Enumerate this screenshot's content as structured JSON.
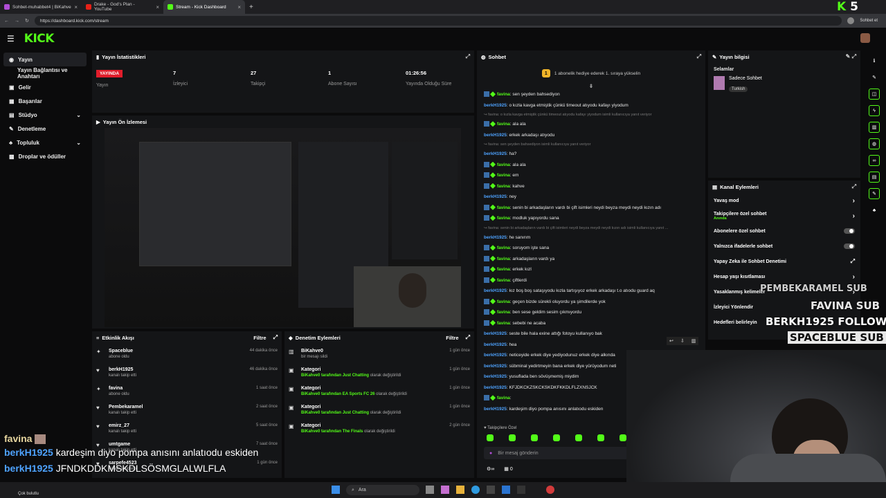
{
  "browser": {
    "tabs": [
      {
        "title": "Sohbet-muhabbet4 | BiKahve"
      },
      {
        "title": "Drake - God's Plan - YouTube"
      },
      {
        "title": "Stream - Kick Dashboard"
      }
    ],
    "url": "https://dashboard.kick.com/stream",
    "profile_label": "Sohbet et"
  },
  "brand": {
    "logo": "KICK",
    "corner_badge": "5"
  },
  "sidebar": {
    "items": [
      {
        "label": "Yayın",
        "icon": "broadcast-icon"
      },
      {
        "label": "Yayın Bağlantısı ve Anahtarı",
        "icon": ""
      },
      {
        "label": "Gelir",
        "icon": "wallet-icon"
      },
      {
        "label": "Başarılar",
        "icon": "trophy-icon"
      },
      {
        "label": "Stüdyo",
        "icon": "studio-icon"
      },
      {
        "label": "Denetleme",
        "icon": "wrench-icon"
      },
      {
        "label": "Topluluk",
        "icon": "community-icon"
      },
      {
        "label": "Droplar ve ödüller",
        "icon": "drop-icon"
      }
    ]
  },
  "stats": {
    "title": "Yayın İstatistikleri",
    "live_badge": "YAYINDA",
    "live_label": "Yayın",
    "viewers": "7",
    "viewers_label": "İzleyici",
    "followers": "27",
    "followers_label": "Takipçi",
    "subs": "1",
    "subs_label": "Abone Sayısı",
    "uptime": "01:26:56",
    "uptime_label": "Yayında Olduğu Süre"
  },
  "preview": {
    "title": "Yayın Ön İzlemesi"
  },
  "activity": {
    "title": "Etkinlik Akışı",
    "filter": "Filtre",
    "items": [
      {
        "name": "Spaceblue",
        "action": "abone oldu",
        "time": "44 dakika önce"
      },
      {
        "name": "berkH1925",
        "action": "kanalı takip etti",
        "time": "46 dakika önce"
      },
      {
        "name": "favina",
        "action": "abone oldu",
        "time": "1 saat önce"
      },
      {
        "name": "Pembekaramel",
        "action": "kanalı takip etti",
        "time": "2 saat önce"
      },
      {
        "name": "emirz_27",
        "action": "kanalı takip etti",
        "time": "5 saat önce"
      },
      {
        "name": "umtgame",
        "action": "kanalı takip etti",
        "time": "7 saat önce"
      },
      {
        "name": "sarpefe4523",
        "action": "kanalı takip etti",
        "time": "1 gün önce"
      }
    ]
  },
  "moderation": {
    "title": "Denetim Eylemleri",
    "filter": "Filtre",
    "items": [
      {
        "title": "BiKahve0",
        "sub_pre": "bir mesajı sildi",
        "sub_green": "",
        "sub_post": "",
        "time": "1 gün önce"
      },
      {
        "title": "Kategori",
        "sub_pre": "BiKahve0 tarafından",
        "sub_green": "Just Chatting",
        "sub_post": "olarak değiştirildi",
        "time": "1 gün önce"
      },
      {
        "title": "Kategori",
        "sub_pre": "BiKahve0 tarafından",
        "sub_green": "EA Sports FC 26",
        "sub_post": "olarak değiştirildi",
        "time": "1 gün önce"
      },
      {
        "title": "Kategori",
        "sub_pre": "BiKahve0 tarafından",
        "sub_green": "Just Chatting",
        "sub_post": "olarak değiştirildi",
        "time": "1 gün önce"
      },
      {
        "title": "Kategori",
        "sub_pre": "BiKahve0 tarafından",
        "sub_green": "The Finals",
        "sub_post": "olarak değiştirildi",
        "time": "2 gün önce"
      }
    ]
  },
  "chat": {
    "title": "Sohbet",
    "gift_banner": "1 abonelik hediye ederek 1. sıraya yükselin",
    "gift_rank": "1",
    "input_placeholder": "Bir mesaj gönderin",
    "followers_only": "Takipçilere Özel",
    "count": "0",
    "messages": [
      {
        "type": "msg",
        "user": "favina",
        "sub": true,
        "text": ": sen şeyden bahsediyon"
      },
      {
        "type": "msg",
        "user": "berkH1925",
        "sub": false,
        "text": ": o kızla kavga etmiştik çünkü timeout atıyodu kafayı yiyodum"
      },
      {
        "type": "reply",
        "text": "favina: o kızla kavga etmiştik çünkü timeout atıyodu kafayı yiyodum isimli kullanıcıya yanıt veriyor"
      },
      {
        "type": "msg",
        "user": "favina",
        "sub": true,
        "text": ": ala ala"
      },
      {
        "type": "msg",
        "user": "berkH1925",
        "sub": false,
        "text": ": erkek arkadaşı atıyodu"
      },
      {
        "type": "reply",
        "text": "favina: sen şeyden bahsediyon isimli kullanıcıya yanıt veriyor"
      },
      {
        "type": "msg",
        "user": "berkH1925",
        "sub": false,
        "text": ": ha?"
      },
      {
        "type": "msg",
        "user": "favina",
        "sub": true,
        "text": ": ala ala"
      },
      {
        "type": "msg",
        "user": "favina",
        "sub": true,
        "text": ": em"
      },
      {
        "type": "msg",
        "user": "favina",
        "sub": true,
        "text": ": kahve"
      },
      {
        "type": "msg",
        "user": "berkH1925",
        "sub": false,
        "text": ": ney"
      },
      {
        "type": "msg",
        "user": "favina",
        "sub": true,
        "text": ": senin bi arkadaşların vardı bi çift isimleri neydi beyza meydi neydi kızın adı"
      },
      {
        "type": "msg",
        "user": "favina",
        "sub": true,
        "text": ": modluk yapıyordu sana"
      },
      {
        "type": "reply",
        "text": "favina: senin bi arkadaşların vardı bi çift isimleri neydi beyza meydi neydi kızın adı isimli kullanıcıya yanıt ..."
      },
      {
        "type": "msg",
        "user": "berkH1925",
        "sub": false,
        "text": ": he sanırım"
      },
      {
        "type": "msg",
        "user": "favina",
        "sub": true,
        "text": ": soruyom işte sana"
      },
      {
        "type": "msg",
        "user": "favina",
        "sub": true,
        "text": ": arkadaşların vardı ya"
      },
      {
        "type": "msg",
        "user": "favina",
        "sub": true,
        "text": ": erkek kızl"
      },
      {
        "type": "msg",
        "user": "favina",
        "sub": true,
        "text": ": çiftlerdi"
      },
      {
        "type": "msg",
        "user": "berkH1925",
        "sub": false,
        "text": ": kız boş boş sataşıyodu kızla tartışıyoz erkek arkadaşı t.o atıodu guard aq"
      },
      {
        "type": "msg",
        "user": "favina",
        "sub": true,
        "text": ": geçen bizde sürekli oluyordu ya şimdilerde yok"
      },
      {
        "type": "msg",
        "user": "favina",
        "sub": true,
        "text": ": ben sese geldim sesim çıkmıyordu"
      },
      {
        "type": "msg",
        "user": "favina",
        "sub": true,
        "text": ": sebebi ne acaba"
      },
      {
        "type": "msg",
        "user": "berkH1925",
        "sub": false,
        "text": ": seste bile hala exine attığı fotoyu kullanıyo bak"
      },
      {
        "type": "msg",
        "user": "berkH1925",
        "sub": false,
        "text": ": hea"
      },
      {
        "type": "msg",
        "user": "berkH1925",
        "sub": false,
        "text": ": neticeyide erkek diye yediyodunuz erkek diye alkında"
      },
      {
        "type": "msg",
        "user": "berkH1925",
        "sub": false,
        "text": ": sübminal yedirtmeyin bana erkek diye yürüyodum neti"
      },
      {
        "type": "msg",
        "user": "berkH1925",
        "sub": false,
        "text": ": yusuflada ben sövüşmemiş miydim"
      },
      {
        "type": "msg",
        "user": "berkH1925",
        "sub": false,
        "text": ": KFJDKCKZSKCKSKDKFKKDLFLZXNSJCK"
      },
      {
        "type": "msg",
        "user": "favina",
        "sub": true,
        "text": ":"
      },
      {
        "type": "msg",
        "user": "berkH1925",
        "sub": false,
        "text": ": kardeşim diyo pompa anısını anlatıodu eskiden"
      },
      {
        "type": "msg",
        "user": "berkH1925",
        "sub": false,
        "text": ": JFNDKDDKMSKDLSÖSMGLALWLFLA"
      }
    ]
  },
  "stream_info": {
    "title": "Yayın bilgisi",
    "stream_title": "Selamlar",
    "category": "Sadece Sohbet",
    "tag": "Turkish"
  },
  "channel_actions": {
    "title": "Kanal Eylemleri",
    "items": [
      {
        "label": "Yavaş mod",
        "sub": "",
        "control": "chevron"
      },
      {
        "label": "Takipçilere özel sohbet",
        "sub": "Anında",
        "control": "chevron"
      },
      {
        "label": "Abonelere özel sohbet",
        "sub": "",
        "control": "toggle"
      },
      {
        "label": "Yalnızca ifadelerle sohbet",
        "sub": "",
        "control": "toggle"
      },
      {
        "label": "Yapay Zeka ile Sohbet Denetimi",
        "sub": "",
        "control": "external"
      },
      {
        "label": "Hesap yaşı kısıtlaması",
        "sub": "",
        "control": "chevron"
      },
      {
        "label": "Yasaklanmış kelimeler",
        "sub": "",
        "control": "chevron"
      },
      {
        "label": "İzleyici Yönlendir",
        "sub": "",
        "control": ""
      },
      {
        "label": "Hedefleri belirleyin",
        "sub": "",
        "control": ""
      }
    ]
  },
  "overlay": {
    "events": [
      {
        "text": "PEMBEKARAMEL SUB"
      },
      {
        "text": "FAVINA SUB"
      },
      {
        "text": "BERKH1925 FOLLOW"
      },
      {
        "text": "SPACEBLUE SUB"
      }
    ],
    "chat": [
      {
        "user": "favina",
        "text": ""
      },
      {
        "user": "berkH1925",
        "text": "kardeşim diyo pompa anısını anlatıodu eskiden"
      },
      {
        "user": "berkH1925",
        "text": "JFNDKDDKMSKDLSÖSMGLALWLFLA"
      }
    ]
  },
  "taskbar": {
    "search": "Ara",
    "weather": "Çok bulutlu"
  },
  "colors": {
    "accent": "#53fc18",
    "live": "#e11d2b",
    "username": "#4ea3ff",
    "panel": "#141517"
  }
}
